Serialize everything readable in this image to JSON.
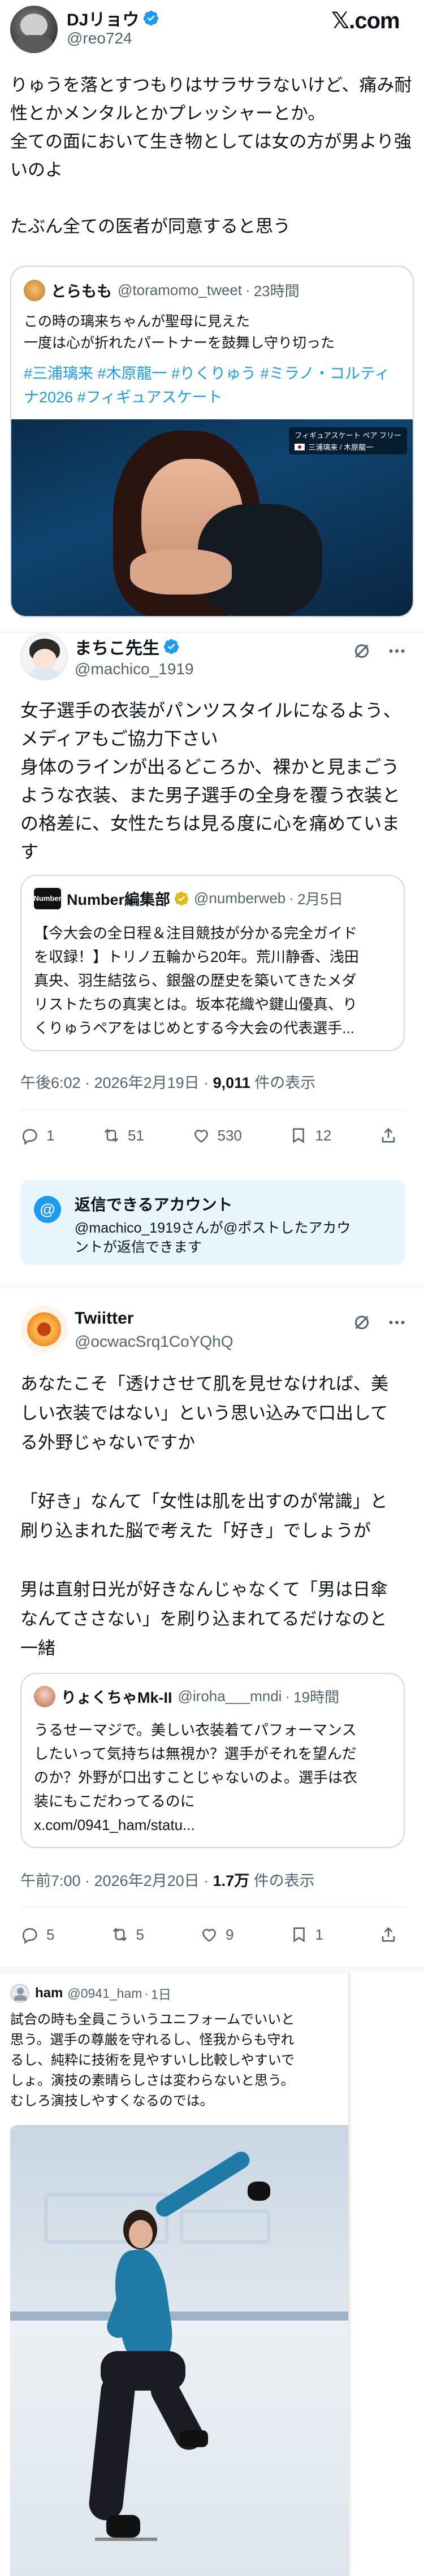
{
  "brand": {
    "logo_text": "𝕏.com"
  },
  "post1": {
    "name": "DJリョウ",
    "handle": "@reo724",
    "lines": [
      "りゅうを落とすつもりはサラサラないけど、痛み耐",
      "性とかメンタルとかプレッシャーとか。",
      "全ての面において生き物としては女の方が男より強",
      "いのよ",
      "",
      "たぶん全ての医者が同意すると思う"
    ],
    "quote": {
      "name": "とらもも",
      "handle": "@toramomo_tweet",
      "time": "23時間",
      "lines": [
        "この時の璃来ちゃんが聖母に見えた",
        "一度は心が折れたパートナーを鼓舞し守り切った"
      ],
      "hashtags_line1": "#三浦璃来 #木原龍一 #りくりゅう #ミラノ・コルティ",
      "hashtags_line2": "ナ2026 #フィギュアスケート",
      "image_caption_1": "フィギュアスケート ペア フリー",
      "image_caption_2": "三浦璃来 / 木原龍一"
    }
  },
  "post2": {
    "name": "まちこ先生",
    "handle": "@machico_1919",
    "lines": [
      "女子選手の衣装がパンツスタイルになるよう、",
      "メディアもご協力下さい",
      "身体のラインが出るどころか、裸かと見まごう",
      "ような衣装、また男子選手の全身を覆う衣装と",
      "の格差に、女性たちは見る度に心を痛めていま",
      "す"
    ],
    "quote": {
      "logo": "Number",
      "name": "Number編集部",
      "handle": "@numberweb",
      "time": "2月5日",
      "lines": [
        "【今大会の全日程＆注目競技が分かる完全ガイド",
        "を収録！】トリノ五輪から20年。荒川静香、浅田",
        "真央、羽生結弦ら、銀盤の歴史を築いてきたメダ",
        "リストたちの真実とは。坂本花織や鍵山優真、り",
        "くりゅうペアをはじめとする今大会の代表選手..."
      ]
    },
    "time": "午後6:02 · 2026年2月19日 · ",
    "views": "9,011",
    "views_label": " 件の表示",
    "replies": "1",
    "reposts": "51",
    "likes": "530",
    "bookmarks": "12",
    "reply_box_title": "返信できるアカウント",
    "reply_box_text_1": "@machico_1919さんが@ポストしたアカウ",
    "reply_box_text_2": "ントが返信できます"
  },
  "post3": {
    "name": "Twiitter",
    "handle": "@ocwacSrq1CoYQhQ",
    "lines": [
      "あなたこそ「透けさせて肌を見せなければ、美",
      "しい衣装ではない」という思い込みで口出して",
      "る外野じゃないですか",
      "",
      "「好き」なんて「女性は肌を出すのが常識」と",
      "刷り込まれた脳で考えた「好き」でしょうが",
      "",
      "男は直射日光が好きなんじゃなくて「男は日傘",
      "なんてささない」を刷り込まれてるだけなのと",
      "一緒"
    ],
    "quote": {
      "name": "りょくちゃMk-II",
      "handle": "@iroha___mndi",
      "time": "19時間",
      "lines": [
        "うるせーマジで。美しい衣装着てパフォーマンス",
        "したいって気持ちは無視か？選手がそれを望んだ",
        "のか？外野が口出すことじゃないのよ。選手は衣",
        "装にもこだわってるのに",
        "x.com/0941_ham/statu..."
      ]
    },
    "time": "午前7:00 · 2026年2月20日 · ",
    "views": "1.7万",
    "views_label": " 件の表示",
    "replies": "5",
    "reposts": "5",
    "likes": "9",
    "bookmarks": "1"
  },
  "post4": {
    "name": "ham",
    "handle": "@0941_ham",
    "time": "1日",
    "lines": [
      "試合の時も全員こういうユニフォームでいいと",
      "思う。選手の尊厳を守れるし、怪我からも守れ",
      "るし、純粋に技術を見やすいし比較しやすいで",
      "しょ。演技の素晴らしさは変わらないと思う。",
      "むしろ演技しやすくなるのでは。"
    ]
  },
  "colors": {
    "link": "#1d9bf0",
    "text": "#0f1419",
    "muted": "#536471",
    "verified": "#1d9bf0",
    "gold": "#e2b719"
  }
}
